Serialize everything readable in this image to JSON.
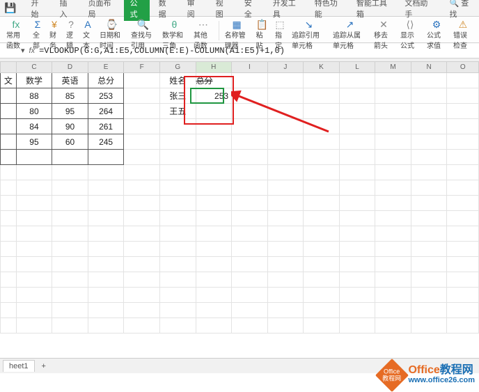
{
  "tabs": {
    "items": [
      "开始",
      "插入",
      "页面布局",
      "公式",
      "数据",
      "审阅",
      "视图",
      "安全",
      "开发工具",
      "特色功能",
      "智能工具箱",
      "文档助手"
    ],
    "active_index": 3,
    "search_label": "查找"
  },
  "ribbon": {
    "items": [
      {
        "label": "常用函数",
        "dd": true,
        "iconColor": "green",
        "glyph": "fx"
      },
      {
        "label": "全部",
        "dd": true,
        "iconColor": "blue",
        "glyph": "Σ"
      },
      {
        "label": "财务",
        "dd": true,
        "iconColor": "orange",
        "glyph": "¥"
      },
      {
        "label": "逻辑",
        "dd": true,
        "iconColor": "gray",
        "glyph": "?"
      },
      {
        "label": "文本",
        "dd": true,
        "iconColor": "blue",
        "glyph": "A"
      },
      {
        "label": "日期和时间",
        "dd": true,
        "iconColor": "orange",
        "glyph": "⌚"
      },
      {
        "label": "查找与引用",
        "dd": true,
        "iconColor": "blue",
        "glyph": "🔍"
      },
      {
        "label": "数学和三角",
        "dd": true,
        "iconColor": "green",
        "glyph": "θ"
      },
      {
        "label": "其他函数",
        "dd": true,
        "iconColor": "gray",
        "glyph": "⋯"
      }
    ],
    "right": [
      {
        "label": "名称管理器",
        "glyph": "▦"
      },
      {
        "label": "粘贴",
        "glyph": "📋"
      },
      {
        "label": "指定",
        "glyph": "⬚"
      },
      {
        "label": "追踪引用单元格",
        "glyph": "↘"
      },
      {
        "label": "追踪从属单元格",
        "glyph": "↗"
      },
      {
        "label": "移去箭头",
        "dd": true,
        "glyph": "✕"
      },
      {
        "label": "显示公式",
        "glyph": "⟨⟩"
      },
      {
        "label": "公式求值",
        "glyph": "⚙"
      },
      {
        "label": "错误检查",
        "dd": true,
        "glyph": "⚠"
      }
    ]
  },
  "formula_bar": {
    "formula": "=VLOOKUP(G:G,A1:E5,COLUMN(E:E)-COLUMN(A1:E5)+1,0)"
  },
  "columns": [
    "C",
    "D",
    "E",
    "F",
    "G",
    "H",
    "I",
    "J",
    "K",
    "L",
    "M",
    "N",
    "O"
  ],
  "active_column": "H",
  "table1": {
    "headers": [
      "数学",
      "英语",
      "总分"
    ],
    "rows": [
      [
        "88",
        "85",
        "253"
      ],
      [
        "80",
        "95",
        "264"
      ],
      [
        "84",
        "90",
        "261"
      ],
      [
        "95",
        "60",
        "245"
      ]
    ]
  },
  "table2": {
    "headers": [
      "姓名",
      "总分"
    ],
    "rows": [
      [
        "张三",
        "253"
      ],
      [
        "王五",
        ""
      ]
    ]
  },
  "sheet_tabs": {
    "active": "heet1"
  },
  "watermark": {
    "title_a": "Office",
    "title_b": "教程网",
    "url": "www.office26.com"
  }
}
